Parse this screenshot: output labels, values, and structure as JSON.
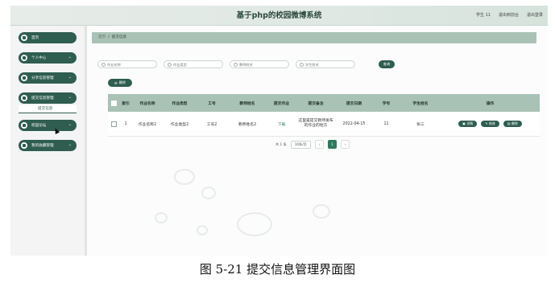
{
  "app": {
    "title": "基于php的校园微博系统",
    "top_links": [
      "学生 11",
      "退出到前台",
      "退出登录"
    ]
  },
  "sidebar": {
    "items": [
      {
        "label": "首页",
        "icon": "home-icon",
        "chevron": ""
      },
      {
        "label": "个人中心",
        "icon": "user-icon",
        "chevron": "⌄"
      },
      {
        "label": "分享信息管理",
        "icon": "grid-icon",
        "chevron": "⌄"
      },
      {
        "label": "提交信息管理",
        "icon": "grid-icon",
        "chevron": "⌄",
        "subitems": [
          "提交信息"
        ]
      },
      {
        "label": "校园论坛",
        "icon": "grid-icon",
        "chevron": "⌄"
      },
      {
        "label": "我的收藏管理",
        "icon": "grid-icon",
        "chevron": "⌄"
      }
    ]
  },
  "breadcrumb": {
    "home": "首页",
    "separator": "/",
    "current": "提交信息"
  },
  "search": {
    "placeholders": [
      "作业名称",
      "作业类型",
      "教师姓名",
      "学生姓名"
    ],
    "query_label": "查询",
    "delete_label": "删除"
  },
  "table": {
    "headers": [
      "索引",
      "作业名称",
      "作业类型",
      "工号",
      "教师姓名",
      "提交作业",
      "提交备注",
      "提交日期",
      "学号",
      "学生姓名",
      "操作"
    ],
    "rows": [
      {
        "index": "1",
        "name": "作业名称2",
        "type": "作业类型2",
        "job_no": "工号2",
        "teacher": "教师姓名2",
        "file": "下载",
        "note": "这里是提交教师发布的作业的地方",
        "date": "2022-04-15",
        "student_no": "11",
        "student": "张三"
      }
    ],
    "actions": [
      "详情",
      "修改",
      "删除"
    ]
  },
  "pagination": {
    "total": "共 1 条",
    "page_size": "10条/页",
    "prev": "‹",
    "current": "1",
    "next": "›"
  },
  "caption": "图 5-21 提交信息管理界面图",
  "colors": {
    "primary": "#2f5d50",
    "header_bg": "#a9c2b6",
    "accent": "#2f7a5e"
  }
}
